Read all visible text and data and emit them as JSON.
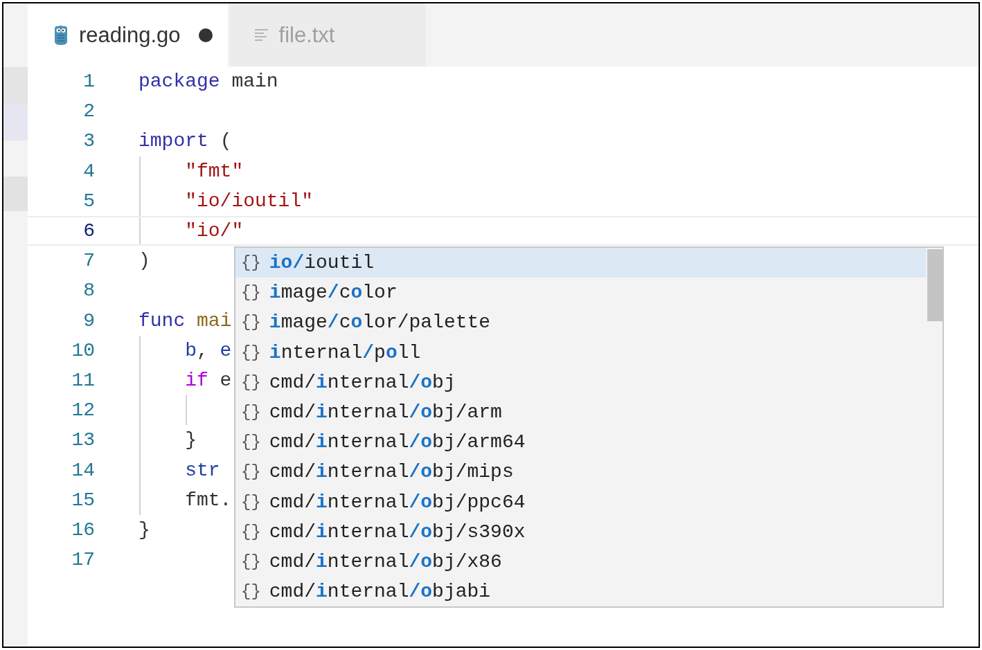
{
  "tabs": [
    {
      "label": "reading.go",
      "kind": "go",
      "selected": true,
      "modified": true
    },
    {
      "label": "file.txt",
      "kind": "text",
      "selected": false,
      "modified": false
    }
  ],
  "lines": [
    {
      "number": "1",
      "current": false,
      "indented": false,
      "nested": false,
      "tokens": [
        {
          "text": "package",
          "kind": "keyword"
        },
        {
          "text": " main",
          "kind": "plain"
        }
      ]
    },
    {
      "number": "2",
      "current": false,
      "indented": false,
      "nested": false
    },
    {
      "number": "3",
      "current": false,
      "indented": false,
      "nested": false,
      "tokens": [
        {
          "text": "import",
          "kind": "keyword"
        },
        {
          "text": " (",
          "kind": "plain"
        }
      ]
    },
    {
      "number": "4",
      "current": false,
      "indented": true,
      "nested": false,
      "tokens": [
        {
          "text": "\"fmt\"",
          "kind": "string"
        }
      ]
    },
    {
      "number": "5",
      "current": false,
      "indented": true,
      "nested": false,
      "tokens": [
        {
          "text": "\"io/ioutil\"",
          "kind": "string"
        }
      ]
    },
    {
      "number": "6",
      "current": true,
      "indented": true,
      "nested": false,
      "tokens": [
        {
          "text": "\"io/\"",
          "kind": "string"
        }
      ]
    },
    {
      "number": "7",
      "current": false,
      "indented": false,
      "nested": false,
      "tokens": [
        {
          "text": ")",
          "kind": "plain"
        }
      ]
    },
    {
      "number": "8",
      "current": false,
      "indented": false,
      "nested": false
    },
    {
      "number": "9",
      "current": false,
      "indented": false,
      "nested": false,
      "tokens": [
        {
          "text": "func",
          "kind": "keyword"
        },
        {
          "text": " mai",
          "kind": "function"
        }
      ]
    },
    {
      "number": "10",
      "current": false,
      "indented": true,
      "nested": false,
      "tokens": [
        {
          "text": "b",
          "kind": "variable"
        },
        {
          "text": ", ",
          "kind": "plain"
        },
        {
          "text": "e",
          "kind": "variable"
        }
      ]
    },
    {
      "number": "11",
      "current": false,
      "indented": true,
      "nested": false,
      "tokens": [
        {
          "text": "if",
          "kind": "control"
        },
        {
          "text": " e",
          "kind": "plain"
        }
      ]
    },
    {
      "number": "12",
      "current": false,
      "indented": true,
      "nested": true
    },
    {
      "number": "13",
      "current": false,
      "indented": true,
      "nested": false,
      "tokens": [
        {
          "text": "}",
          "kind": "plain"
        }
      ]
    },
    {
      "number": "14",
      "current": false,
      "indented": true,
      "nested": false,
      "tokens": [
        {
          "text": "str",
          "kind": "variable"
        }
      ]
    },
    {
      "number": "15",
      "current": false,
      "indented": true,
      "nested": false,
      "tokens": [
        {
          "text": "fmt.",
          "kind": "plain"
        }
      ]
    },
    {
      "number": "16",
      "current": false,
      "indented": false,
      "nested": false,
      "tokens": [
        {
          "text": "}",
          "kind": "plain"
        }
      ]
    },
    {
      "number": "17",
      "current": false,
      "indented": false,
      "nested": false
    }
  ],
  "suggestions": [
    {
      "icon": "{}",
      "label": "**io/**ioutil",
      "selected": true
    },
    {
      "icon": "{}",
      "label": "**i**mage**/**c**o**lor",
      "selected": false
    },
    {
      "icon": "{}",
      "label": "**i**mage**/**c**o**lor/palette",
      "selected": false
    },
    {
      "icon": "{}",
      "label": "**i**nternal**/**p**o**ll",
      "selected": false
    },
    {
      "icon": "{}",
      "label": "cmd/**i**nternal**/o**bj",
      "selected": false
    },
    {
      "icon": "{}",
      "label": "cmd/**i**nternal**/o**bj/arm",
      "selected": false
    },
    {
      "icon": "{}",
      "label": "cmd/**i**nternal**/o**bj/arm64",
      "selected": false
    },
    {
      "icon": "{}",
      "label": "cmd/**i**nternal**/o**bj/mips",
      "selected": false
    },
    {
      "icon": "{}",
      "label": "cmd/**i**nternal**/o**bj/ppc64",
      "selected": false
    },
    {
      "icon": "{}",
      "label": "cmd/**i**nternal**/o**bj/s390x",
      "selected": false
    },
    {
      "icon": "{}",
      "label": "cmd/**i**nternal**/o**bj/x86",
      "selected": false
    },
    {
      "icon": "{}",
      "label": "cmd/**i**nternal**/o**bjabi",
      "selected": false
    }
  ]
}
